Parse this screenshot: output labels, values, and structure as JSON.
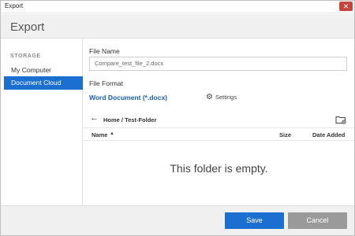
{
  "window": {
    "title": "Export",
    "close_glyph": "✕"
  },
  "header": {
    "title": "Export"
  },
  "sidebar": {
    "section_label": "STORAGE",
    "items": [
      {
        "label": "My Computer",
        "selected": false
      },
      {
        "label": "Document Cloud",
        "selected": true
      }
    ]
  },
  "form": {
    "file_name_label": "File Name",
    "file_name_value": "Compare_test_file_2.docx",
    "file_format_label": "File Format",
    "file_format_value": "Word Document (*.docx)",
    "settings_label": "Settings"
  },
  "browser": {
    "breadcrumb": "Home / Test-Folder",
    "columns": {
      "name": "Name",
      "size": "Size",
      "date_added": "Date Added"
    },
    "sort": "ascending",
    "empty_message": "This folder is empty."
  },
  "footer": {
    "save_label": "Save",
    "cancel_label": "Cancel"
  },
  "colors": {
    "accent": "#1a6fd1",
    "link": "#1a5fb4",
    "cancel": "#9a9a9a",
    "close": "#c7463c"
  },
  "icons": [
    "close-icon",
    "gear-icon",
    "back-arrow-icon",
    "new-folder-icon",
    "sort-ascending-icon"
  ]
}
